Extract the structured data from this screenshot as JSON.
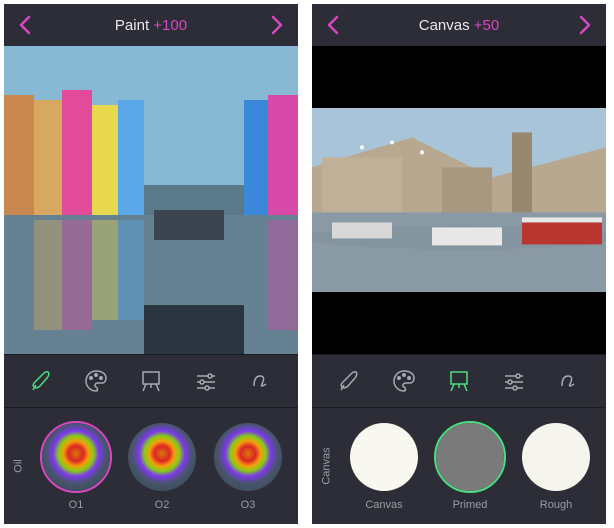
{
  "screens": [
    {
      "title_prefix": "Paint ",
      "title_value": "+100",
      "vlabel": "Oil",
      "thumbs": [
        {
          "label": "O1",
          "selected": true
        },
        {
          "label": "O2",
          "selected": false
        },
        {
          "label": "O3",
          "selected": false
        }
      ],
      "active_tool": "brush"
    },
    {
      "title_prefix": "Canvas ",
      "title_value": "+50",
      "vlabel": "Canvas",
      "thumbs": [
        {
          "label": "Canvas",
          "selected": false
        },
        {
          "label": "Primed",
          "selected": true
        },
        {
          "label": "Rough",
          "selected": false
        }
      ],
      "active_tool": "easel"
    }
  ],
  "tools": [
    "brush",
    "palette",
    "easel",
    "sliders",
    "signature"
  ]
}
